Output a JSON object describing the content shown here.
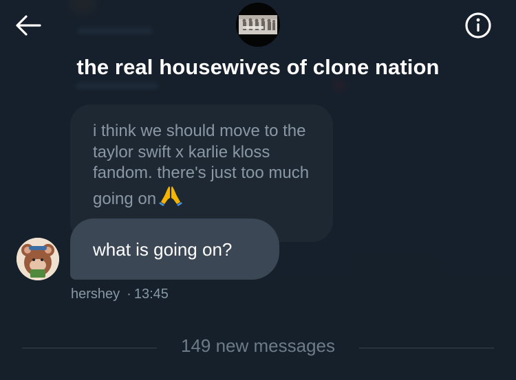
{
  "header": {
    "back_icon": "arrow-left-icon",
    "info_icon": "info-circle-icon",
    "group_avatar_icon": "group-photo",
    "title": "the real housewives of clone nation"
  },
  "conversation": {
    "quoted_message": {
      "text": "i think we should move to the taylor swift x karlie kloss fandom. there's just too much going on",
      "emoji": "🙏"
    },
    "message": {
      "text": "what is going on?",
      "sender": "hershey",
      "separator": "·",
      "time": "13:45",
      "avatar_icon": "cartoon-mouse-avatar"
    },
    "divider_text": "149 new messages"
  },
  "colors": {
    "background": "#15202b",
    "bubble": "#3b4754",
    "quoted_bubble": "#1e2833",
    "secondary_text": "#8899a6"
  }
}
